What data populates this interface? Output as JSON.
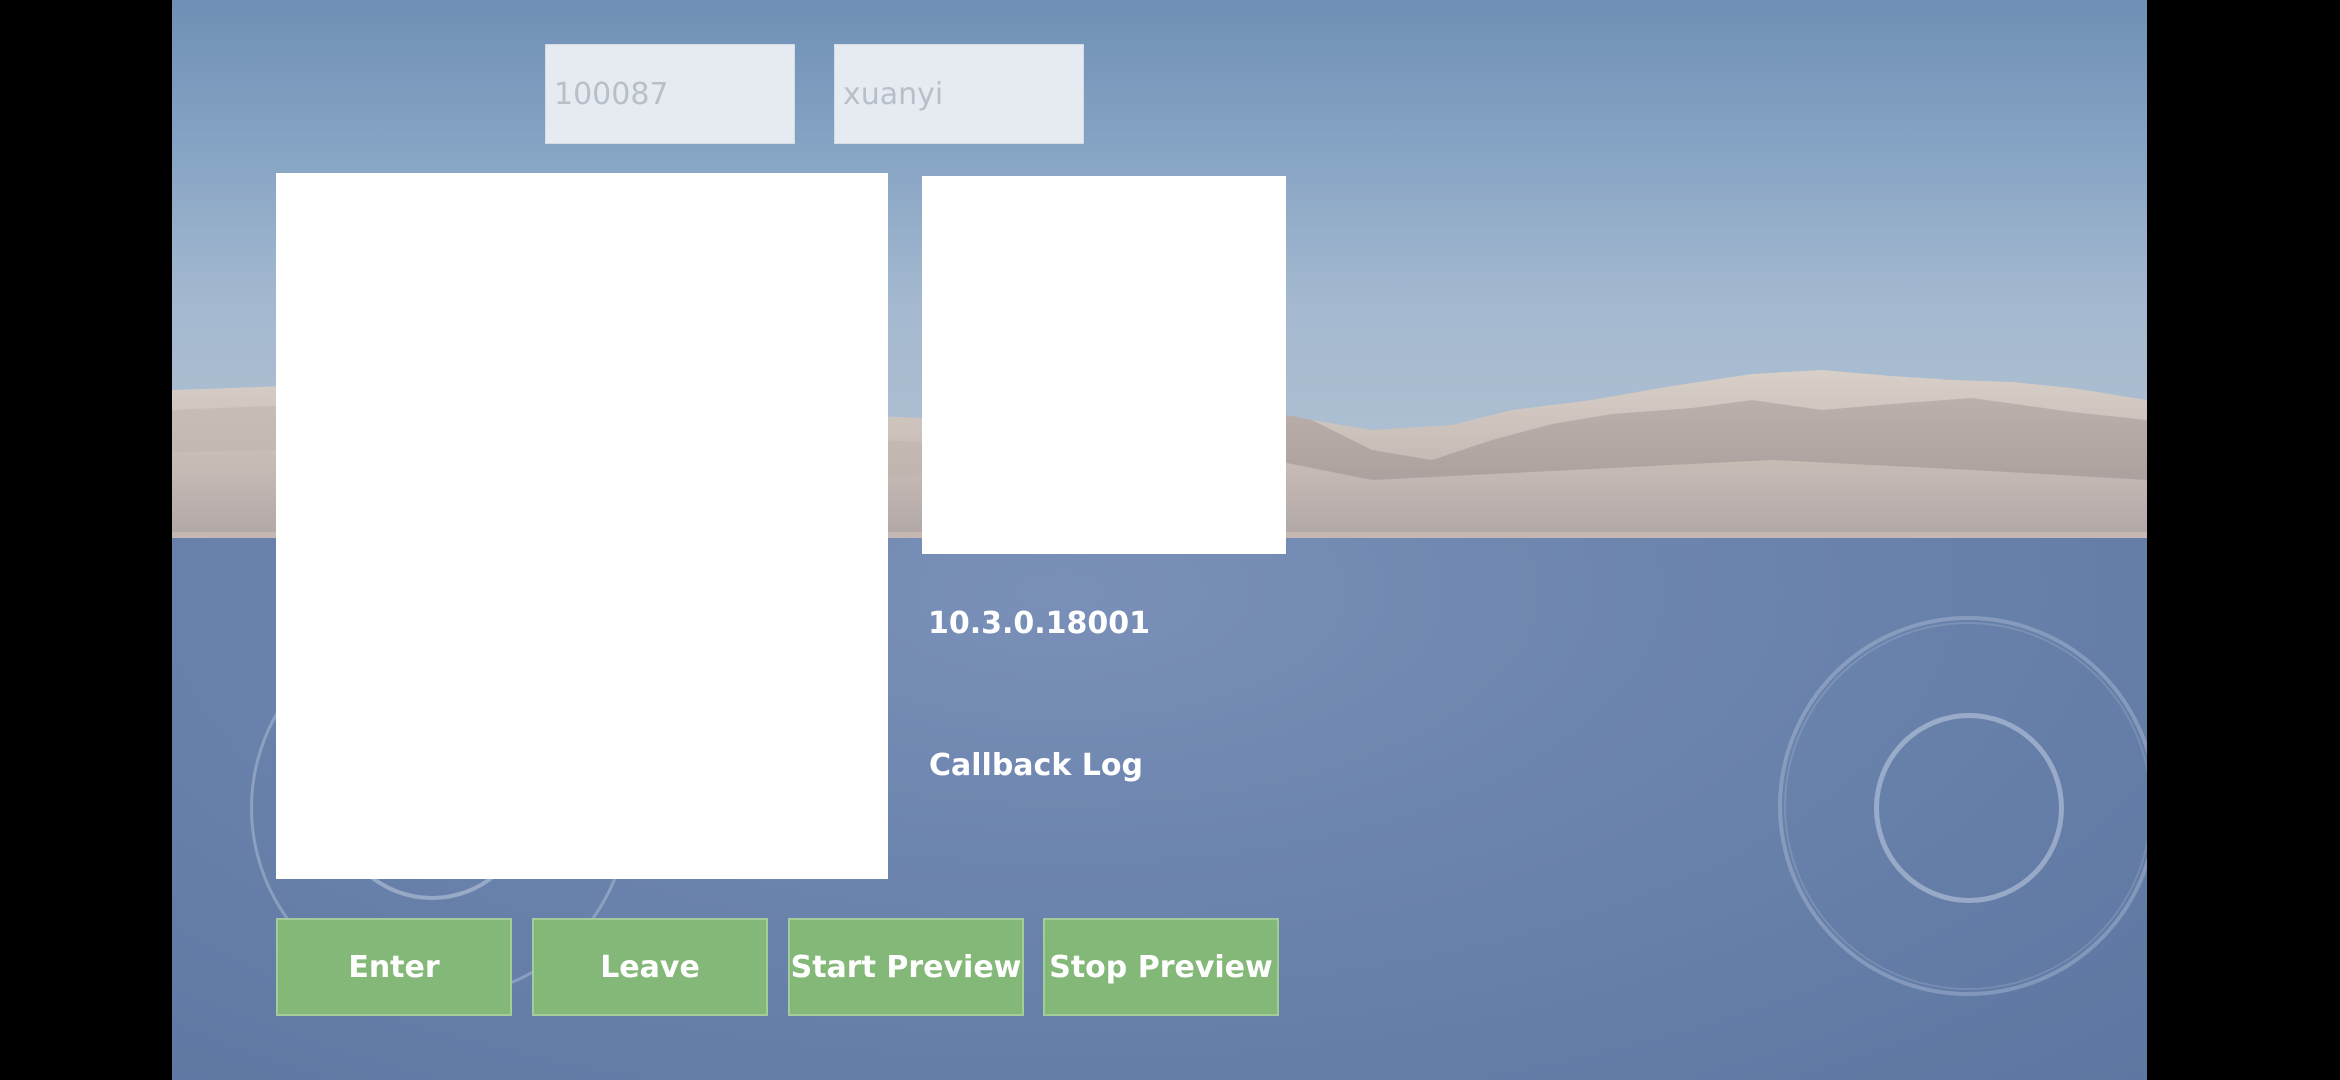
{
  "inputs": {
    "room_id": "100087",
    "user_id": "xuanyi"
  },
  "info": {
    "version": "10.3.0.18001",
    "callback_log": "Callback Log"
  },
  "buttons": {
    "enter": "Enter",
    "leave": "Leave",
    "start_preview": "Start Preview",
    "stop_preview": "Stop Preview"
  },
  "colors": {
    "button_bg": "#84b879",
    "input_bg": "#e6ebf2",
    "panel_bg": "#ffffff",
    "sky_top": "#6f8fb6",
    "ground": "#6c85ae"
  }
}
